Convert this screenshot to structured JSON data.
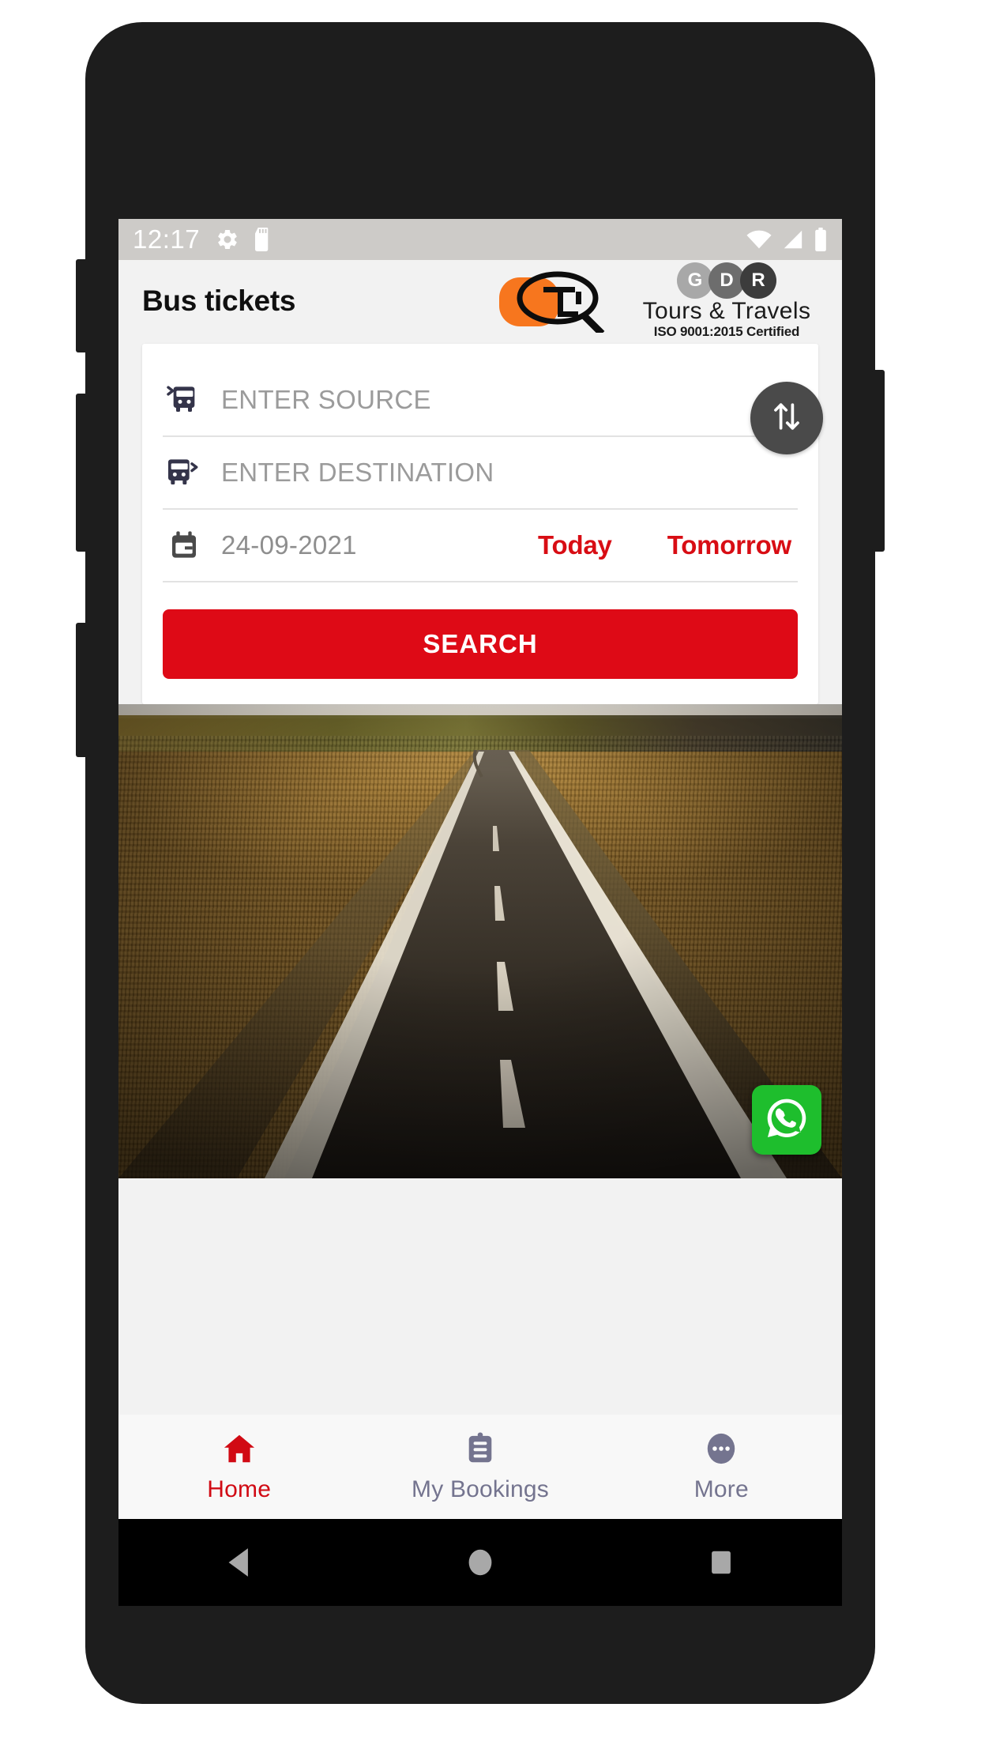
{
  "status_bar": {
    "time": "12:17",
    "left_icons": [
      "gear-icon",
      "sd-card-icon"
    ],
    "right_icons": [
      "wifi-icon",
      "signal-icon",
      "battery-icon"
    ],
    "background": "#cdcbc8"
  },
  "app_bar": {
    "title": "Bus tickets",
    "logo": {
      "monogram_alt": "GDR magnifier monogram",
      "blob_color": "#f7761e",
      "letters": [
        "G",
        "D",
        "R"
      ],
      "letter_colors": [
        "#a8a8a8",
        "#6d6d6d",
        "#3c3c3c"
      ],
      "company": "Tours & Travels",
      "certification": "ISO 9001:2015 Certified"
    }
  },
  "search_card": {
    "source": {
      "icon": "bus-departure-icon",
      "value": "",
      "placeholder": "ENTER SOURCE"
    },
    "destination": {
      "icon": "bus-arrival-icon",
      "value": "",
      "placeholder": "ENTER DESTINATION"
    },
    "swap": {
      "icon": "swap-vertical-icon",
      "background": "#4a4a4a"
    },
    "date": {
      "icon": "calendar-icon",
      "value": "24-09-2021",
      "today_label": "Today",
      "tomorrow_label": "Tomorrow",
      "quick_color": "#d80d14"
    },
    "search_button": {
      "label": "SEARCH",
      "background": "#de0a16"
    }
  },
  "hero": {
    "alt": "Empty asphalt road vanishing toward horizon through golden fields"
  },
  "whatsapp_fab": {
    "icon": "whatsapp-icon",
    "background": "#1ebe2d"
  },
  "bottom_nav": {
    "active_color": "#d10a14",
    "inactive_color": "#74748f",
    "items": [
      {
        "label": "Home",
        "icon": "home-icon",
        "active": true
      },
      {
        "label": "My Bookings",
        "icon": "clipboard-icon",
        "active": false
      },
      {
        "label": "More",
        "icon": "ellipsis-icon",
        "active": false
      }
    ]
  },
  "android_nav": {
    "buttons": [
      "back-icon",
      "home-circle-icon",
      "recents-square-icon"
    ]
  }
}
